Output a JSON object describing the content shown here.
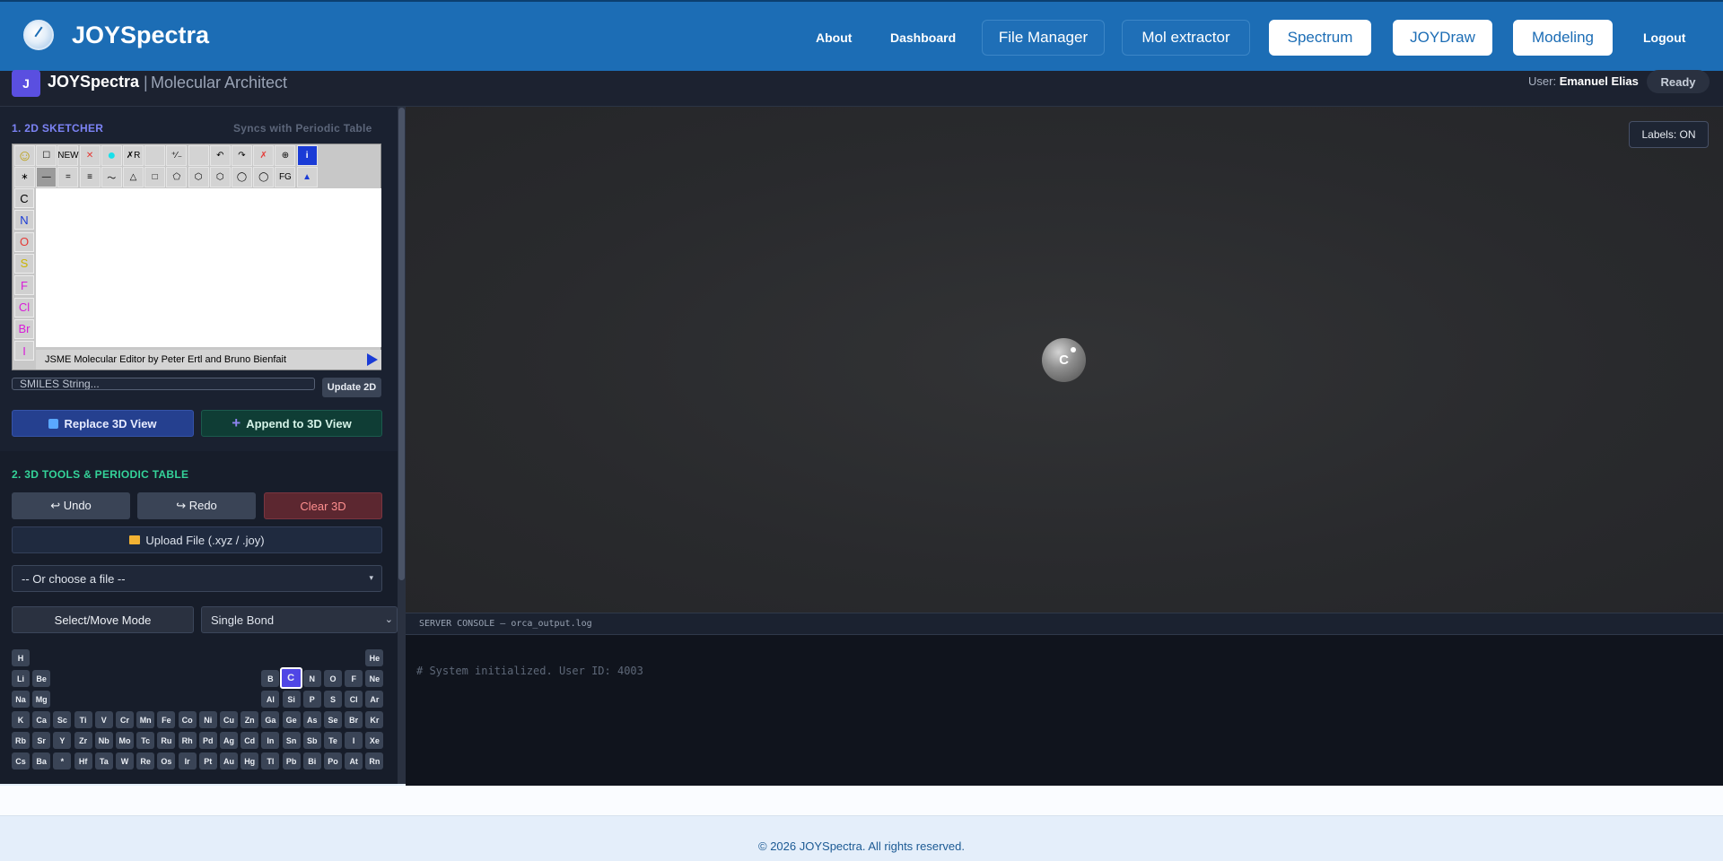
{
  "nav": {
    "app_title": "JOYSpectra",
    "about": "About",
    "dashboard": "Dashboard",
    "file_manager": "File Manager",
    "mol_extractor": "Mol extractor",
    "spectrum": "Spectrum",
    "joydraw": "JOYDraw",
    "modeling": "Modeling",
    "logout": "Logout"
  },
  "subheader": {
    "badge": "J",
    "brand": "JOYSpectra",
    "separator": "|",
    "subtitle": "Molecular Architect",
    "user_label": "User:",
    "user_name": "Emanuel Elias",
    "status": "Ready"
  },
  "sketcher": {
    "title": "1. 2D SKETCHER",
    "sync_note": "Syncs with Periodic Table",
    "toolbar_row1": [
      "☺",
      "☐",
      "NEW",
      "✕",
      "●",
      "✗R",
      "",
      "⁺⁄₋",
      "",
      "↶",
      "↷",
      "✗",
      "⊕",
      "i"
    ],
    "toolbar_row2": [
      "∗",
      "—",
      "=",
      "≡",
      "〜",
      "△",
      "□",
      "⬠",
      "⬡",
      "⬡",
      "◯",
      "◯",
      "FG",
      "▲"
    ],
    "elements": [
      {
        "symbol": "C",
        "color": "#000000"
      },
      {
        "symbol": "N",
        "color": "#1a3bd6"
      },
      {
        "symbol": "O",
        "color": "#e53935"
      },
      {
        "symbol": "S",
        "color": "#c9b400"
      },
      {
        "symbol": "F",
        "color": "#d81bd8"
      },
      {
        "symbol": "Cl",
        "color": "#d81bd8"
      },
      {
        "symbol": "Br",
        "color": "#d81bd8"
      },
      {
        "symbol": "I",
        "color": "#d81bd8"
      }
    ],
    "footer": "JSME Molecular Editor by Peter Ertl and Bruno Bienfait",
    "smiles_placeholder": "SMILES String...",
    "update_button": "Update 2D",
    "replace_button": "Replace 3D View",
    "append_button": "Append to 3D View"
  },
  "tools": {
    "title": "2. 3D TOOLS & PERIODIC TABLE",
    "undo": "↩ Undo",
    "redo": "↪ Redo",
    "clear": "Clear 3D",
    "upload": "Upload File (.xyz / .joy)",
    "file_select": "-- Or choose a file --",
    "mode_button": "Select/Move Mode",
    "bond_select": "Single Bond"
  },
  "periodic_table": {
    "selected": "C",
    "rows": [
      [
        "H",
        "He"
      ],
      [
        "Li",
        "Be",
        "B",
        "C",
        "N",
        "O",
        "F",
        "Ne"
      ],
      [
        "Na",
        "Mg",
        "Al",
        "Si",
        "P",
        "S",
        "Cl",
        "Ar"
      ],
      [
        "K",
        "Ca",
        "Sc",
        "Ti",
        "V",
        "Cr",
        "Mn",
        "Fe",
        "Co",
        "Ni",
        "Cu",
        "Zn",
        "Ga",
        "Ge",
        "As",
        "Se",
        "Br",
        "Kr"
      ],
      [
        "Rb",
        "Sr",
        "Y",
        "Zr",
        "Nb",
        "Mo",
        "Tc",
        "Ru",
        "Rh",
        "Pd",
        "Ag",
        "Cd",
        "In",
        "Sn",
        "Sb",
        "Te",
        "I",
        "Xe"
      ],
      [
        "Cs",
        "Ba",
        "*",
        "Hf",
        "Ta",
        "W",
        "Re",
        "Os",
        "Ir",
        "Pt",
        "Au",
        "Hg",
        "Tl",
        "Pb",
        "Bi",
        "Po",
        "At",
        "Rn"
      ]
    ]
  },
  "viewer": {
    "labels_toggle": "Labels: ON",
    "atom_label": "C"
  },
  "console": {
    "header": "SERVER CONSOLE — orca_output.log",
    "line": "# System initialized. User ID: 4003"
  },
  "footer": {
    "copyright": "© 2026 JOYSpectra. All rights reserved."
  },
  "colors": {
    "nav_bg": "#1c6db5",
    "sidebar_bg": "#1a2130",
    "accent_purple": "#4f46e5",
    "section1_title": "#7c83f5",
    "section2_title": "#34d399"
  }
}
